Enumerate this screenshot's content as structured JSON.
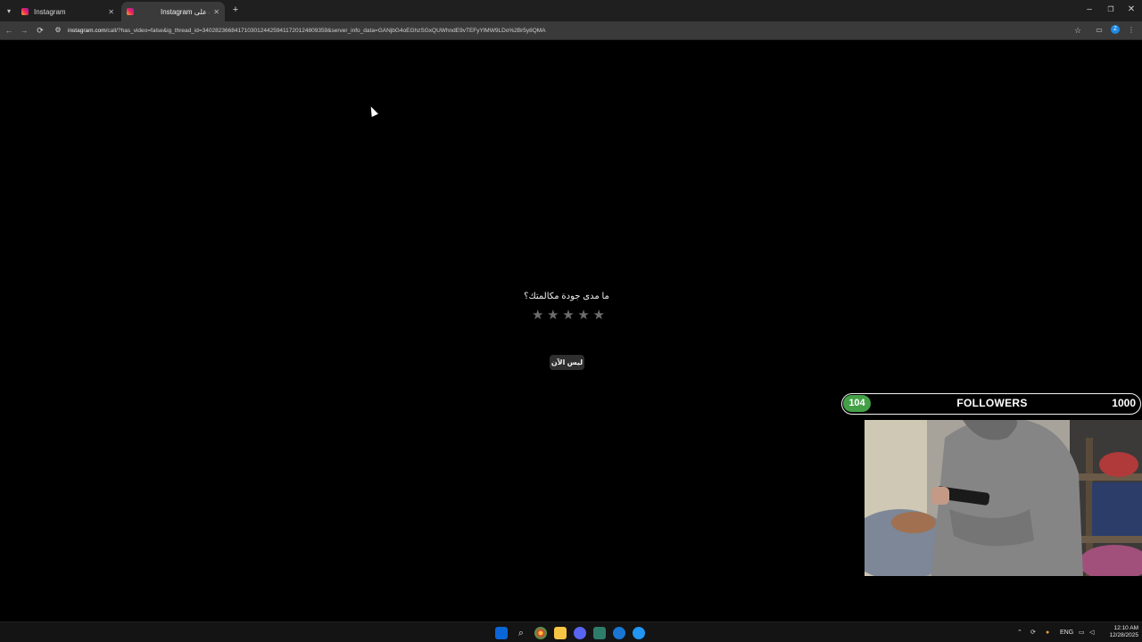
{
  "browser": {
    "tabs": [
      {
        "title": "Instagram",
        "active": false
      },
      {
        "title": "Instagram مكالمة على",
        "active": true
      }
    ],
    "tab_search_icon": "chevron-down-icon",
    "new_tab_icon": "+",
    "window_controls": {
      "minimize": "–",
      "restore": "❐",
      "close": "✕"
    },
    "nav": {
      "back": "←",
      "forward": "→",
      "reload": "⟳"
    },
    "url_host": "instagram.com",
    "url_rest": "/call/?has_video=false&ig_thread_id=340282366841710301244259411720124809359&server_info_data=GANjbG4oEGhzSGxQUWhndE9vTEFyYlMW9LDo%2Br5y8QMA",
    "profile_initial": "Z"
  },
  "call_rating": {
    "question": "ما مدى جودة مكالمتك؟",
    "stars": [
      "★",
      "★",
      "★",
      "★",
      "★"
    ],
    "not_now_label": "ليس الآن"
  },
  "overlay": {
    "followers_current": "104",
    "followers_label": "FOLLOWERS",
    "followers_goal": "1000",
    "progress_fraction": 0.104
  },
  "taskbar": {
    "tray_language": "ENG",
    "time": "12:10 AM",
    "date": "12/28/2025"
  },
  "colors": {
    "accent_green": "#43a047",
    "page_bg": "#000000",
    "star_inactive": "#6d6d6d"
  }
}
